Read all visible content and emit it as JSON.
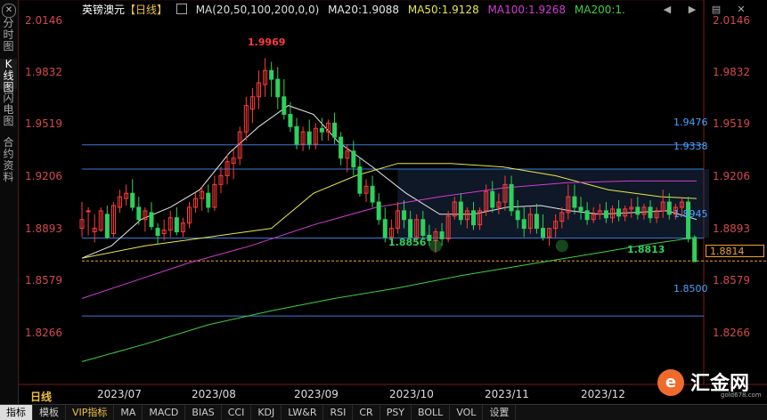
{
  "sidebar": {
    "tabs": [
      {
        "label": "分时图",
        "active": false
      },
      {
        "label": "K线图",
        "active": true
      },
      {
        "label": "闪电图",
        "active": false
      },
      {
        "label": "合约资料",
        "active": false
      }
    ]
  },
  "legend": {
    "symbol": "英镑澳元",
    "period_tag": "【日线】",
    "ma_params": "MA(20,50,100,200,0,0)",
    "ma20": "MA20:1.9088",
    "ma50": "MA50:1.9128",
    "ma100": "MA100:1.9268",
    "ma200": "MA200:1."
  },
  "colors": {
    "up": "#ff3b3b",
    "down": "#2ed05e",
    "ma20": "#e8e8e8",
    "ma50": "#e8e84a",
    "ma100": "#d23cd2",
    "ma200": "#3fd03f",
    "level": "#3a7bd5",
    "axis_text": "#d04a4a"
  },
  "yaxis": {
    "ticks": [
      "2.0146",
      "1.9832",
      "1.9519",
      "1.9206",
      "1.8893",
      "1.8579",
      "1.8266"
    ]
  },
  "xaxis": {
    "ticks": [
      "2023/07",
      "2023/08",
      "2023/09",
      "2023/10",
      "2023/11",
      "2023/12"
    ]
  },
  "levels": [
    "1.9476",
    "1.9338",
    "1.8945",
    "1.8500"
  ],
  "annotations": {
    "high": "1.9969",
    "low": "1.8856",
    "last": "1.8813"
  },
  "current_price": "1.8814",
  "period_label": "日线",
  "bottom_tabs": [
    {
      "label": "指标",
      "active": true,
      "vip": false
    },
    {
      "label": "模板",
      "active": false,
      "vip": false
    },
    {
      "label": "VIP指标",
      "active": false,
      "vip": true
    },
    {
      "label": "MA",
      "active": false,
      "vip": false
    },
    {
      "label": "MACD",
      "active": false,
      "vip": false
    },
    {
      "label": "BIAS",
      "active": false,
      "vip": false
    },
    {
      "label": "CCI",
      "active": false,
      "vip": false
    },
    {
      "label": "KDJ",
      "active": false,
      "vip": false
    },
    {
      "label": "LW&R",
      "active": false,
      "vip": false
    },
    {
      "label": "RSI",
      "active": false,
      "vip": false
    },
    {
      "label": "CR",
      "active": false,
      "vip": false
    },
    {
      "label": "PSY",
      "active": false,
      "vip": false
    },
    {
      "label": "BOLL",
      "active": false,
      "vip": false
    },
    {
      "label": "VOL",
      "active": false,
      "vip": false
    },
    {
      "label": "设置",
      "active": false,
      "vip": false
    }
  ],
  "logo": {
    "text": "汇金网",
    "mark": "e",
    "url": "gold678.com"
  },
  "window_buttons": {
    "prev": "◀",
    "next": "▶",
    "menu": "▤",
    "close": "✕"
  },
  "chart_data": {
    "type": "candlestick",
    "ylim": [
      1.811,
      2.0302
    ],
    "xaxis_labels": [
      "2023/07",
      "2023/08",
      "2023/09",
      "2023/10",
      "2023/11",
      "2023/12"
    ],
    "horizontal_levels": [
      1.9476,
      1.9338,
      1.8945,
      1.85
    ],
    "dashed_level": 1.8814,
    "consolidation_box": [
      1.8945,
      1.9338
    ],
    "ma_series": {
      "ma20": [
        [
          0,
          1.883
        ],
        [
          14,
          1.89
        ],
        [
          28,
          1.905
        ],
        [
          42,
          1.912
        ],
        [
          56,
          1.922
        ],
        [
          70,
          1.943
        ],
        [
          84,
          1.958
        ],
        [
          98,
          1.97
        ],
        [
          110,
          1.965
        ],
        [
          122,
          1.949
        ],
        [
          138,
          1.935
        ],
        [
          154,
          1.92
        ],
        [
          170,
          1.908
        ],
        [
          186,
          1.908
        ],
        [
          202,
          1.912
        ],
        [
          218,
          1.913
        ],
        [
          232,
          1.91
        ],
        [
          246,
          1.908
        ],
        [
          262,
          1.909
        ],
        [
          278,
          1.91
        ],
        [
          292,
          1.905
        ]
      ],
      "ma50": [
        [
          0,
          1.883
        ],
        [
          30,
          1.89
        ],
        [
          60,
          1.895
        ],
        [
          90,
          1.9
        ],
        [
          110,
          1.92
        ],
        [
          130,
          1.93
        ],
        [
          150,
          1.937
        ],
        [
          175,
          1.937
        ],
        [
          200,
          1.935
        ],
        [
          225,
          1.93
        ],
        [
          250,
          1.922
        ],
        [
          275,
          1.918
        ],
        [
          292,
          1.917
        ]
      ],
      "ma100": [
        [
          0,
          1.86
        ],
        [
          25,
          1.87
        ],
        [
          50,
          1.88
        ],
        [
          80,
          1.89
        ],
        [
          110,
          1.902
        ],
        [
          140,
          1.912
        ],
        [
          170,
          1.918
        ],
        [
          200,
          1.923
        ],
        [
          230,
          1.926
        ],
        [
          260,
          1.927
        ],
        [
          292,
          1.927
        ]
      ],
      "ma200": [
        [
          0,
          1.824
        ],
        [
          30,
          1.834
        ],
        [
          60,
          1.845
        ],
        [
          90,
          1.853
        ],
        [
          120,
          1.86
        ],
        [
          150,
          1.866
        ],
        [
          180,
          1.873
        ],
        [
          210,
          1.879
        ],
        [
          240,
          1.885
        ],
        [
          270,
          1.891
        ],
        [
          292,
          1.895
        ]
      ]
    },
    "candles": [
      [
        0,
        1.9,
        1.915,
        1.905,
        1.895
      ],
      [
        3,
        1.91,
        1.912,
        1.91,
        1.896
      ],
      [
        6,
        1.898,
        1.908,
        1.9,
        1.892
      ],
      [
        9,
        1.899,
        1.912,
        1.91,
        1.898
      ],
      [
        12,
        1.908,
        1.913,
        1.895,
        1.894
      ],
      [
        15,
        1.897,
        1.915,
        1.913,
        1.895
      ],
      [
        18,
        1.912,
        1.922,
        1.918,
        1.909
      ],
      [
        21,
        1.917,
        1.925,
        1.92,
        1.913
      ],
      [
        24,
        1.92,
        1.928,
        1.912,
        1.91
      ],
      [
        27,
        1.912,
        1.918,
        1.905,
        1.902
      ],
      [
        30,
        1.905,
        1.912,
        1.91,
        1.898
      ],
      [
        33,
        1.909,
        1.915,
        1.901,
        1.899
      ],
      [
        36,
        1.9,
        1.903,
        1.896,
        1.891
      ],
      [
        39,
        1.897,
        1.905,
        1.899,
        1.893
      ],
      [
        42,
        1.899,
        1.91,
        1.906,
        1.895
      ],
      [
        45,
        1.906,
        1.912,
        1.898,
        1.896
      ],
      [
        48,
        1.898,
        1.906,
        1.903,
        1.895
      ],
      [
        51,
        1.903,
        1.915,
        1.912,
        1.9
      ],
      [
        54,
        1.912,
        1.92,
        1.917,
        1.909
      ],
      [
        57,
        1.917,
        1.924,
        1.921,
        1.91
      ],
      [
        60,
        1.92,
        1.925,
        1.912,
        1.909
      ],
      [
        63,
        1.912,
        1.93,
        1.925,
        1.91
      ],
      [
        66,
        1.925,
        1.935,
        1.93,
        1.92
      ],
      [
        69,
        1.93,
        1.942,
        1.938,
        1.925
      ],
      [
        72,
        1.937,
        1.945,
        1.94,
        1.928
      ],
      [
        75,
        1.94,
        1.958,
        1.955,
        1.936
      ],
      [
        78,
        1.955,
        1.975,
        1.97,
        1.95
      ],
      [
        81,
        1.968,
        1.98,
        1.975,
        1.96
      ],
      [
        84,
        1.975,
        1.99,
        1.983,
        1.968
      ],
      [
        87,
        1.982,
        1.997,
        1.99,
        1.975
      ],
      [
        90,
        1.99,
        1.995,
        1.985,
        1.975
      ],
      [
        93,
        1.985,
        1.992,
        1.975,
        1.968
      ],
      [
        96,
        1.975,
        1.985,
        1.965,
        1.962
      ],
      [
        99,
        1.965,
        1.972,
        1.958,
        1.955
      ],
      [
        102,
        1.958,
        1.963,
        1.948,
        1.945
      ],
      [
        105,
        1.948,
        1.958,
        1.955,
        1.944
      ],
      [
        108,
        1.955,
        1.962,
        1.948,
        1.945
      ],
      [
        111,
        1.948,
        1.96,
        1.957,
        1.945
      ],
      [
        114,
        1.957,
        1.963,
        1.955,
        1.95
      ],
      [
        117,
        1.955,
        1.962,
        1.96,
        1.95
      ],
      [
        120,
        1.96,
        1.966,
        1.952,
        1.948
      ],
      [
        123,
        1.952,
        1.955,
        1.94,
        1.936
      ],
      [
        126,
        1.94,
        1.948,
        1.944,
        1.932
      ],
      [
        129,
        1.944,
        1.95,
        1.935,
        1.93
      ],
      [
        132,
        1.935,
        1.94,
        1.92,
        1.918
      ],
      [
        135,
        1.92,
        1.928,
        1.924,
        1.915
      ],
      [
        138,
        1.924,
        1.93,
        1.915,
        1.912
      ],
      [
        141,
        1.915,
        1.92,
        1.905,
        1.902
      ],
      [
        144,
        1.905,
        1.912,
        1.895,
        1.892
      ],
      [
        147,
        1.895,
        1.905,
        1.9,
        1.89
      ],
      [
        150,
        1.9,
        1.915,
        1.91,
        1.897
      ],
      [
        153,
        1.91,
        1.916,
        1.905,
        1.9
      ],
      [
        156,
        1.905,
        1.91,
        1.895,
        1.893
      ],
      [
        159,
        1.895,
        1.908,
        1.905,
        1.892
      ],
      [
        162,
        1.905,
        1.91,
        1.896,
        1.894
      ],
      [
        165,
        1.896,
        1.902,
        1.893,
        1.89
      ],
      [
        168,
        1.893,
        1.9,
        1.898,
        1.886
      ],
      [
        171,
        1.898,
        1.903,
        1.894,
        1.89
      ],
      [
        174,
        1.894,
        1.91,
        1.907,
        1.892
      ],
      [
        177,
        1.907,
        1.918,
        1.915,
        1.905
      ],
      [
        180,
        1.915,
        1.92,
        1.905,
        1.902
      ],
      [
        183,
        1.905,
        1.912,
        1.91,
        1.9
      ],
      [
        186,
        1.91,
        1.915,
        1.902,
        1.899
      ],
      [
        189,
        1.902,
        1.912,
        1.91,
        1.899
      ],
      [
        192,
        1.91,
        1.925,
        1.921,
        1.907
      ],
      [
        195,
        1.921,
        1.927,
        1.912,
        1.909
      ],
      [
        198,
        1.912,
        1.92,
        1.915,
        1.908
      ],
      [
        201,
        1.915,
        1.93,
        1.925,
        1.91
      ],
      [
        204,
        1.925,
        1.93,
        1.91,
        1.907
      ],
      [
        207,
        1.91,
        1.916,
        1.905,
        1.9
      ],
      [
        210,
        1.905,
        1.912,
        1.9,
        1.895
      ],
      [
        213,
        1.9,
        1.912,
        1.908,
        1.897
      ],
      [
        216,
        1.908,
        1.914,
        1.9,
        1.897
      ],
      [
        219,
        1.9,
        1.908,
        1.895,
        1.893
      ],
      [
        222,
        1.895,
        1.9,
        1.9,
        1.89
      ],
      [
        225,
        1.9,
        1.908,
        1.904,
        1.895
      ],
      [
        228,
        1.904,
        1.912,
        1.909,
        1.9
      ],
      [
        231,
        1.909,
        1.925,
        1.918,
        1.905
      ],
      [
        234,
        1.918,
        1.925,
        1.912,
        1.908
      ],
      [
        237,
        1.912,
        1.918,
        1.91,
        1.905
      ],
      [
        240,
        1.91,
        1.915,
        1.905,
        1.902
      ],
      [
        243,
        1.905,
        1.912,
        1.908,
        1.903
      ],
      [
        246,
        1.908,
        1.914,
        1.91,
        1.905
      ],
      [
        249,
        1.91,
        1.915,
        1.906,
        1.903
      ],
      [
        252,
        1.906,
        1.913,
        1.911,
        1.903
      ],
      [
        255,
        1.911,
        1.916,
        1.907,
        1.904
      ],
      [
        258,
        1.907,
        1.913,
        1.911,
        1.904
      ],
      [
        261,
        1.911,
        1.917,
        1.912,
        1.906
      ],
      [
        264,
        1.912,
        1.918,
        1.908,
        1.905
      ],
      [
        267,
        1.908,
        1.914,
        1.912,
        1.905
      ],
      [
        270,
        1.912,
        1.916,
        1.906,
        1.903
      ],
      [
        273,
        1.906,
        1.912,
        1.91,
        1.903
      ],
      [
        276,
        1.91,
        1.922,
        1.915,
        1.906
      ],
      [
        279,
        1.915,
        1.92,
        1.908,
        1.905
      ],
      [
        282,
        1.908,
        1.914,
        1.912,
        1.905
      ],
      [
        285,
        1.912,
        1.918,
        1.915,
        1.907
      ],
      [
        288,
        1.915,
        1.918,
        1.894,
        1.892
      ],
      [
        291,
        1.894,
        1.896,
        1.881,
        1.881
      ]
    ]
  }
}
